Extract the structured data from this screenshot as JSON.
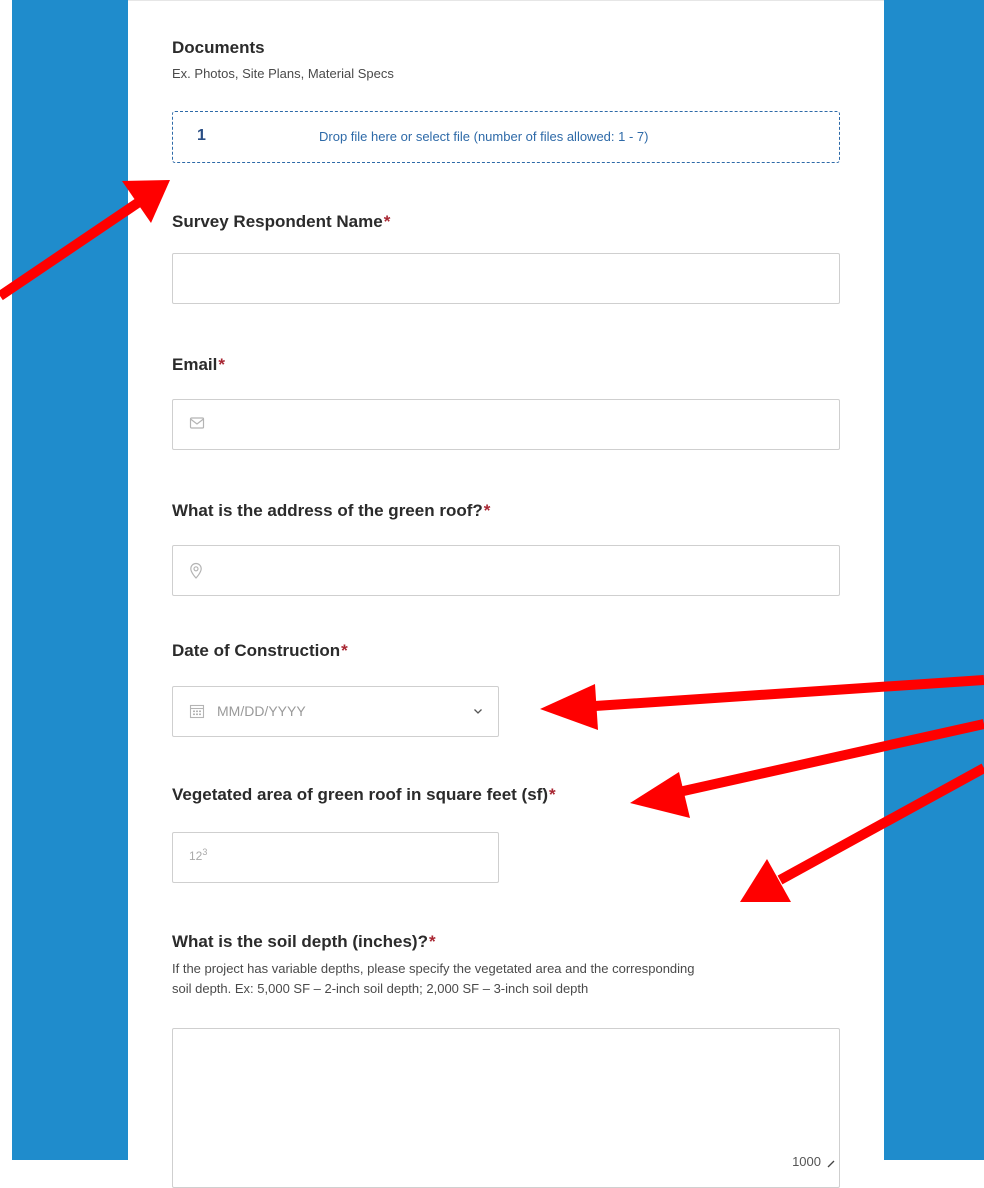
{
  "documents": {
    "label": "Documents",
    "description": "Ex. Photos, Site Plans, Material Specs",
    "file_count": "1",
    "dropzone_text": "Drop file here or select file (number of files allowed: 1 - 7)"
  },
  "respondent_name": {
    "label": "Survey Respondent Name",
    "value": ""
  },
  "email": {
    "label": "Email",
    "value": "",
    "icon": "envelope-icon"
  },
  "address": {
    "label": "What is the address of the green roof?",
    "value": "",
    "icon": "location-pin-icon"
  },
  "construction_date": {
    "label": "Date of Construction",
    "placeholder": "MM/DD/YYYY",
    "icon": "calendar-icon"
  },
  "vegetated_area": {
    "label": "Vegetated area of green roof in square feet (sf)",
    "value": "",
    "icon_text": "12",
    "icon_sup": "3"
  },
  "soil_depth": {
    "label": "What is the soil depth (inches)?",
    "description_line1": "If the project has variable depths, please specify the vegetated area and the corresponding",
    "description_line2": "soil depth. Ex: 5,000 SF – 2-inch soil depth; 2,000 SF – 3-inch soil depth",
    "value": "",
    "char_limit": "1000"
  },
  "required_marker": "*",
  "colors": {
    "background_blue": "#1f8ccc",
    "required_red": "#a82632",
    "dropzone_blue": "#2e6aa8",
    "annotation_arrow": "#ff0000"
  }
}
